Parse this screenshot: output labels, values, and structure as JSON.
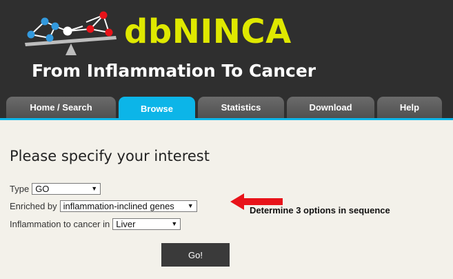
{
  "header": {
    "site_title": "dbNINCA",
    "tagline": "From Inflammation To Cancer"
  },
  "nav": {
    "tabs": [
      {
        "label": "Home / Search",
        "active": false
      },
      {
        "label": "Browse",
        "active": true
      },
      {
        "label": "Statistics",
        "active": false
      },
      {
        "label": "Download",
        "active": false
      },
      {
        "label": "Help",
        "active": false
      }
    ]
  },
  "main": {
    "heading": "Please specify your interest",
    "fields": [
      {
        "label": "Type",
        "value": "GO"
      },
      {
        "label": "Enriched by",
        "value": "inflammation-inclined genes"
      },
      {
        "label": "Inflammation to cancer in",
        "value": "Liver"
      }
    ],
    "go_label": "Go!"
  },
  "annotation": {
    "text": "Determine 3 options in sequence",
    "color": "#e8131a"
  },
  "colors": {
    "header_bg": "#2f2f2f",
    "title": "#dfe800",
    "accent": "#0cb5e8",
    "node_blue": "#3399dd",
    "node_red": "#e8131a"
  }
}
